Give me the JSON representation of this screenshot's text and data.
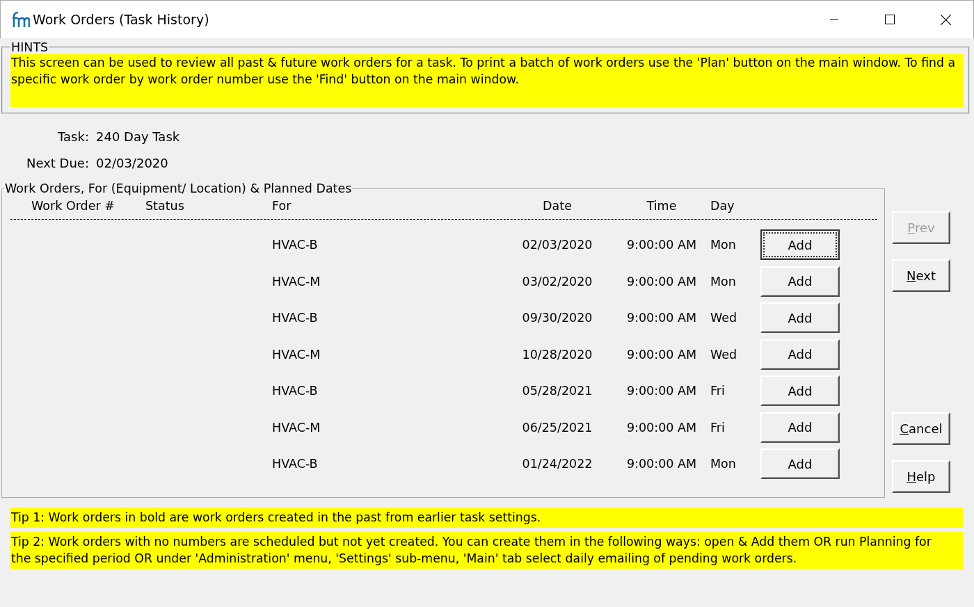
{
  "window": {
    "title": "Work Orders (Task History)"
  },
  "hints": {
    "legend": "HINTS",
    "text": "This screen can be used to review all past & future work orders for a task. To print a batch of work orders use the 'Plan' button on the main window. To find a specific work order by work order number use the 'Find' button on the main window."
  },
  "task": [
    {
      "label": "Task:",
      "value": "240 Day Task"
    },
    {
      "label": "Next Due:",
      "value": "02/03/2020"
    }
  ],
  "work_orders": {
    "legend": "Work Orders, For (Equipment/ Location) & Planned Dates",
    "columns": [
      "Work Order #",
      "Status",
      "For",
      "Date",
      "Time",
      "Day"
    ],
    "rows": [
      {
        "for": "HVAC-B",
        "date": "02/03/2020",
        "time": "9:00:00 AM",
        "day": "Mon",
        "button": {
          "label": "Add",
          "focused": true
        }
      },
      {
        "for": "HVAC-M",
        "date": "03/02/2020",
        "time": "9:00:00 AM",
        "day": "Mon",
        "button": {
          "label": "Add",
          "focused": false
        }
      },
      {
        "for": "HVAC-B",
        "date": "09/30/2020",
        "time": "9:00:00 AM",
        "day": "Wed",
        "button": {
          "label": "Add",
          "focused": false
        }
      },
      {
        "for": "HVAC-M",
        "date": "10/28/2020",
        "time": "9:00:00 AM",
        "day": "Wed",
        "button": {
          "label": "Add",
          "focused": false
        }
      },
      {
        "for": "HVAC-B",
        "date": "05/28/2021",
        "time": "9:00:00 AM",
        "day": "Fri",
        "button": {
          "label": "Add",
          "focused": false
        }
      },
      {
        "for": "HVAC-M",
        "date": "06/25/2021",
        "time": "9:00:00 AM",
        "day": "Fri",
        "button": {
          "label": "Add",
          "focused": false
        }
      },
      {
        "for": "HVAC-B",
        "date": "01/24/2022",
        "time": "9:00:00 AM",
        "day": "Mon",
        "button": {
          "label": "Add",
          "focused": false
        }
      }
    ]
  },
  "side_buttons": [
    {
      "label": "Prev",
      "kind": "nav",
      "disabled": true,
      "underline_first": true
    },
    {
      "label": "Next",
      "kind": "nav",
      "disabled": false,
      "underline_first": true
    },
    {
      "label": "Cancel",
      "kind": "action",
      "disabled": false,
      "underline_first": true
    },
    {
      "label": "Help",
      "kind": "action",
      "disabled": false,
      "underline_first": true
    }
  ],
  "tips": [
    "Tip 1: Work orders in bold are work orders created in the past from earlier task settings.",
    "Tip 2: Work orders with no numbers are scheduled but not yet created. You can create them in the following ways: open & Add them OR run Planning for the specified period OR under 'Administration' menu, 'Settings' sub-menu, 'Main' tab select daily emailing of pending work orders."
  ]
}
